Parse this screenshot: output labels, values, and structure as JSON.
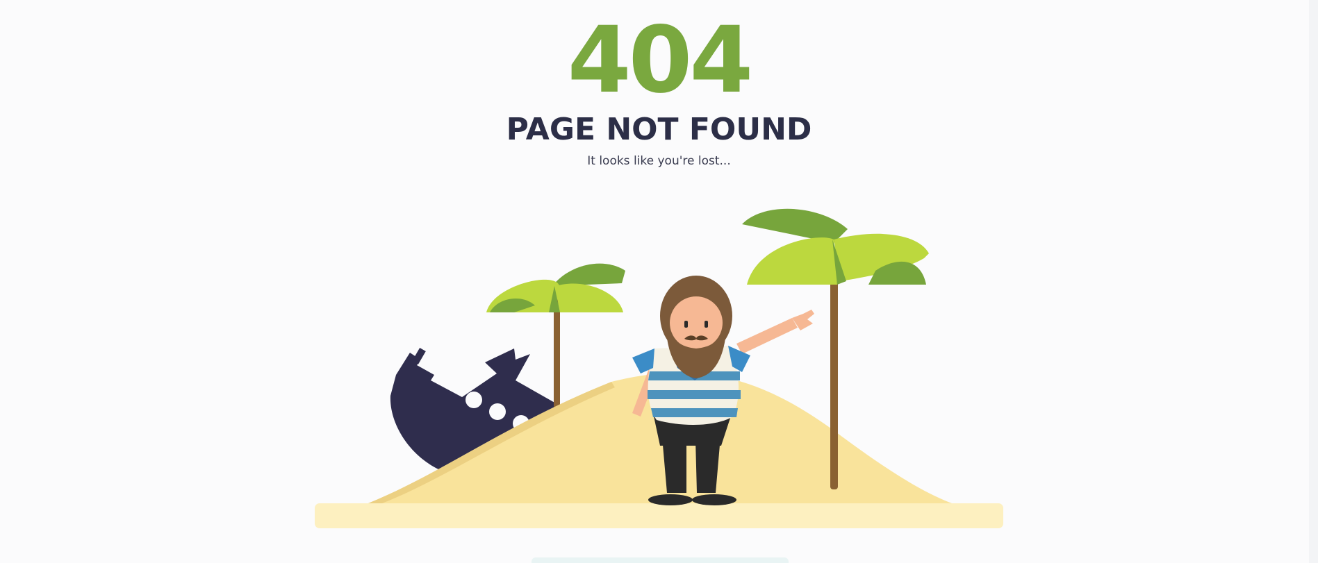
{
  "error": {
    "code": "404",
    "title": "PAGE NOT FOUND",
    "subtitle": "It looks like you're lost..."
  },
  "illustration": {
    "description_icons": [
      "palm-tree-icon",
      "shipwreck-icon",
      "sailor-icon",
      "sand-dune-icon"
    ]
  },
  "colors": {
    "code": "#7aa83f",
    "title": "#2c2e47",
    "sand": "#f9e39b",
    "ground": "#fdf0c0",
    "ship": "#2f2d4d",
    "palm_light": "#bcd83e",
    "palm_dark": "#77a53c",
    "trunk": "#8a6132"
  }
}
